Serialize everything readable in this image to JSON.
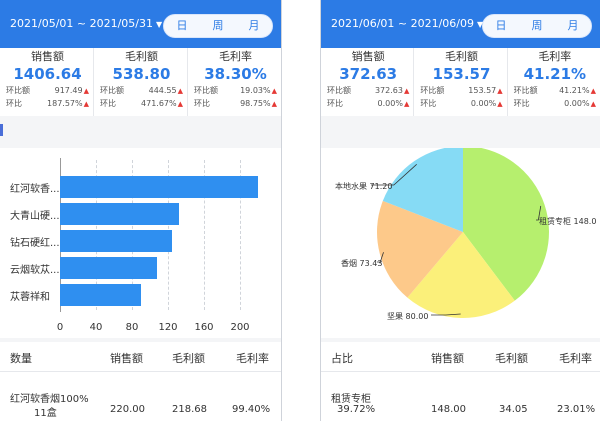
{
  "left": {
    "date_range": "2021/05/01 ~ 2021/05/31",
    "tabs": [
      "日",
      "周",
      "月"
    ],
    "stats": [
      {
        "label": "销售额",
        "value": "1406.64",
        "row1_label": "环比额",
        "row1_value": "917.49",
        "row2_label": "环比",
        "row2_value": "187.57%"
      },
      {
        "label": "毛利额",
        "value": "538.80",
        "row1_label": "环比额",
        "row1_value": "444.55",
        "row2_label": "环比",
        "row2_value": "471.67%"
      },
      {
        "label": "毛利率",
        "value": "38.30%",
        "row1_label": "环比额",
        "row1_value": "19.03%",
        "row2_label": "环比",
        "row2_value": "98.75%"
      }
    ],
    "table": {
      "headers": [
        "数量",
        "销售额",
        "毛利额",
        "毛利率"
      ],
      "row": {
        "name": "红河软香烟100%",
        "qty": "11盒",
        "sales": "220.00",
        "profit": "218.68",
        "rate": "99.40%"
      }
    }
  },
  "right": {
    "date_range": "2021/06/01 ~ 2021/06/09",
    "tabs": [
      "日",
      "周",
      "月"
    ],
    "stats": [
      {
        "label": "销售额",
        "value": "372.63",
        "row1_label": "环比额",
        "row1_value": "372.63",
        "row2_label": "环比",
        "row2_value": "0.00%"
      },
      {
        "label": "毛利额",
        "value": "153.57",
        "row1_label": "环比额",
        "row1_value": "153.57",
        "row2_label": "环比",
        "row2_value": "0.00%"
      },
      {
        "label": "毛利率",
        "value": "41.21%",
        "row1_label": "环比额",
        "row1_value": "41.21%",
        "row2_label": "环比",
        "row2_value": "0.00%"
      }
    ],
    "table": {
      "headers": [
        "占比",
        "销售额",
        "毛利额",
        "毛利率"
      ],
      "row": {
        "name": "租赁专柜",
        "share": "39.72%",
        "sales": "148.00",
        "profit": "34.05",
        "rate": "23.01%"
      }
    }
  },
  "chart_data": [
    {
      "type": "bar",
      "orientation": "horizontal",
      "categories": [
        "红河软香...",
        "大青山硬...",
        "钻石硬红...",
        "云烟软苁...",
        "苁蓉祥和"
      ],
      "values": [
        220,
        132,
        124,
        108,
        90
      ],
      "xlim": [
        0,
        220
      ],
      "ticks": [
        "0",
        "40",
        "80",
        "120",
        "160",
        "200"
      ],
      "grid": true,
      "color": "#2f8ff0"
    },
    {
      "type": "pie",
      "slices": [
        {
          "label": "租赁专柜",
          "value": 148.0,
          "display": "租赁专柜 148.0",
          "color": "#b6ef6e"
        },
        {
          "label": "坚果",
          "value": 80.0,
          "display": "坚果 80.00",
          "color": "#fbf07a"
        },
        {
          "label": "香烟",
          "value": 73.43,
          "display": "香烟 73.43",
          "color": "#fdc98a"
        },
        {
          "label": "本地水果",
          "value": 71.2,
          "display": "本地水果 71.20",
          "color": "#86dbf5"
        }
      ]
    }
  ]
}
